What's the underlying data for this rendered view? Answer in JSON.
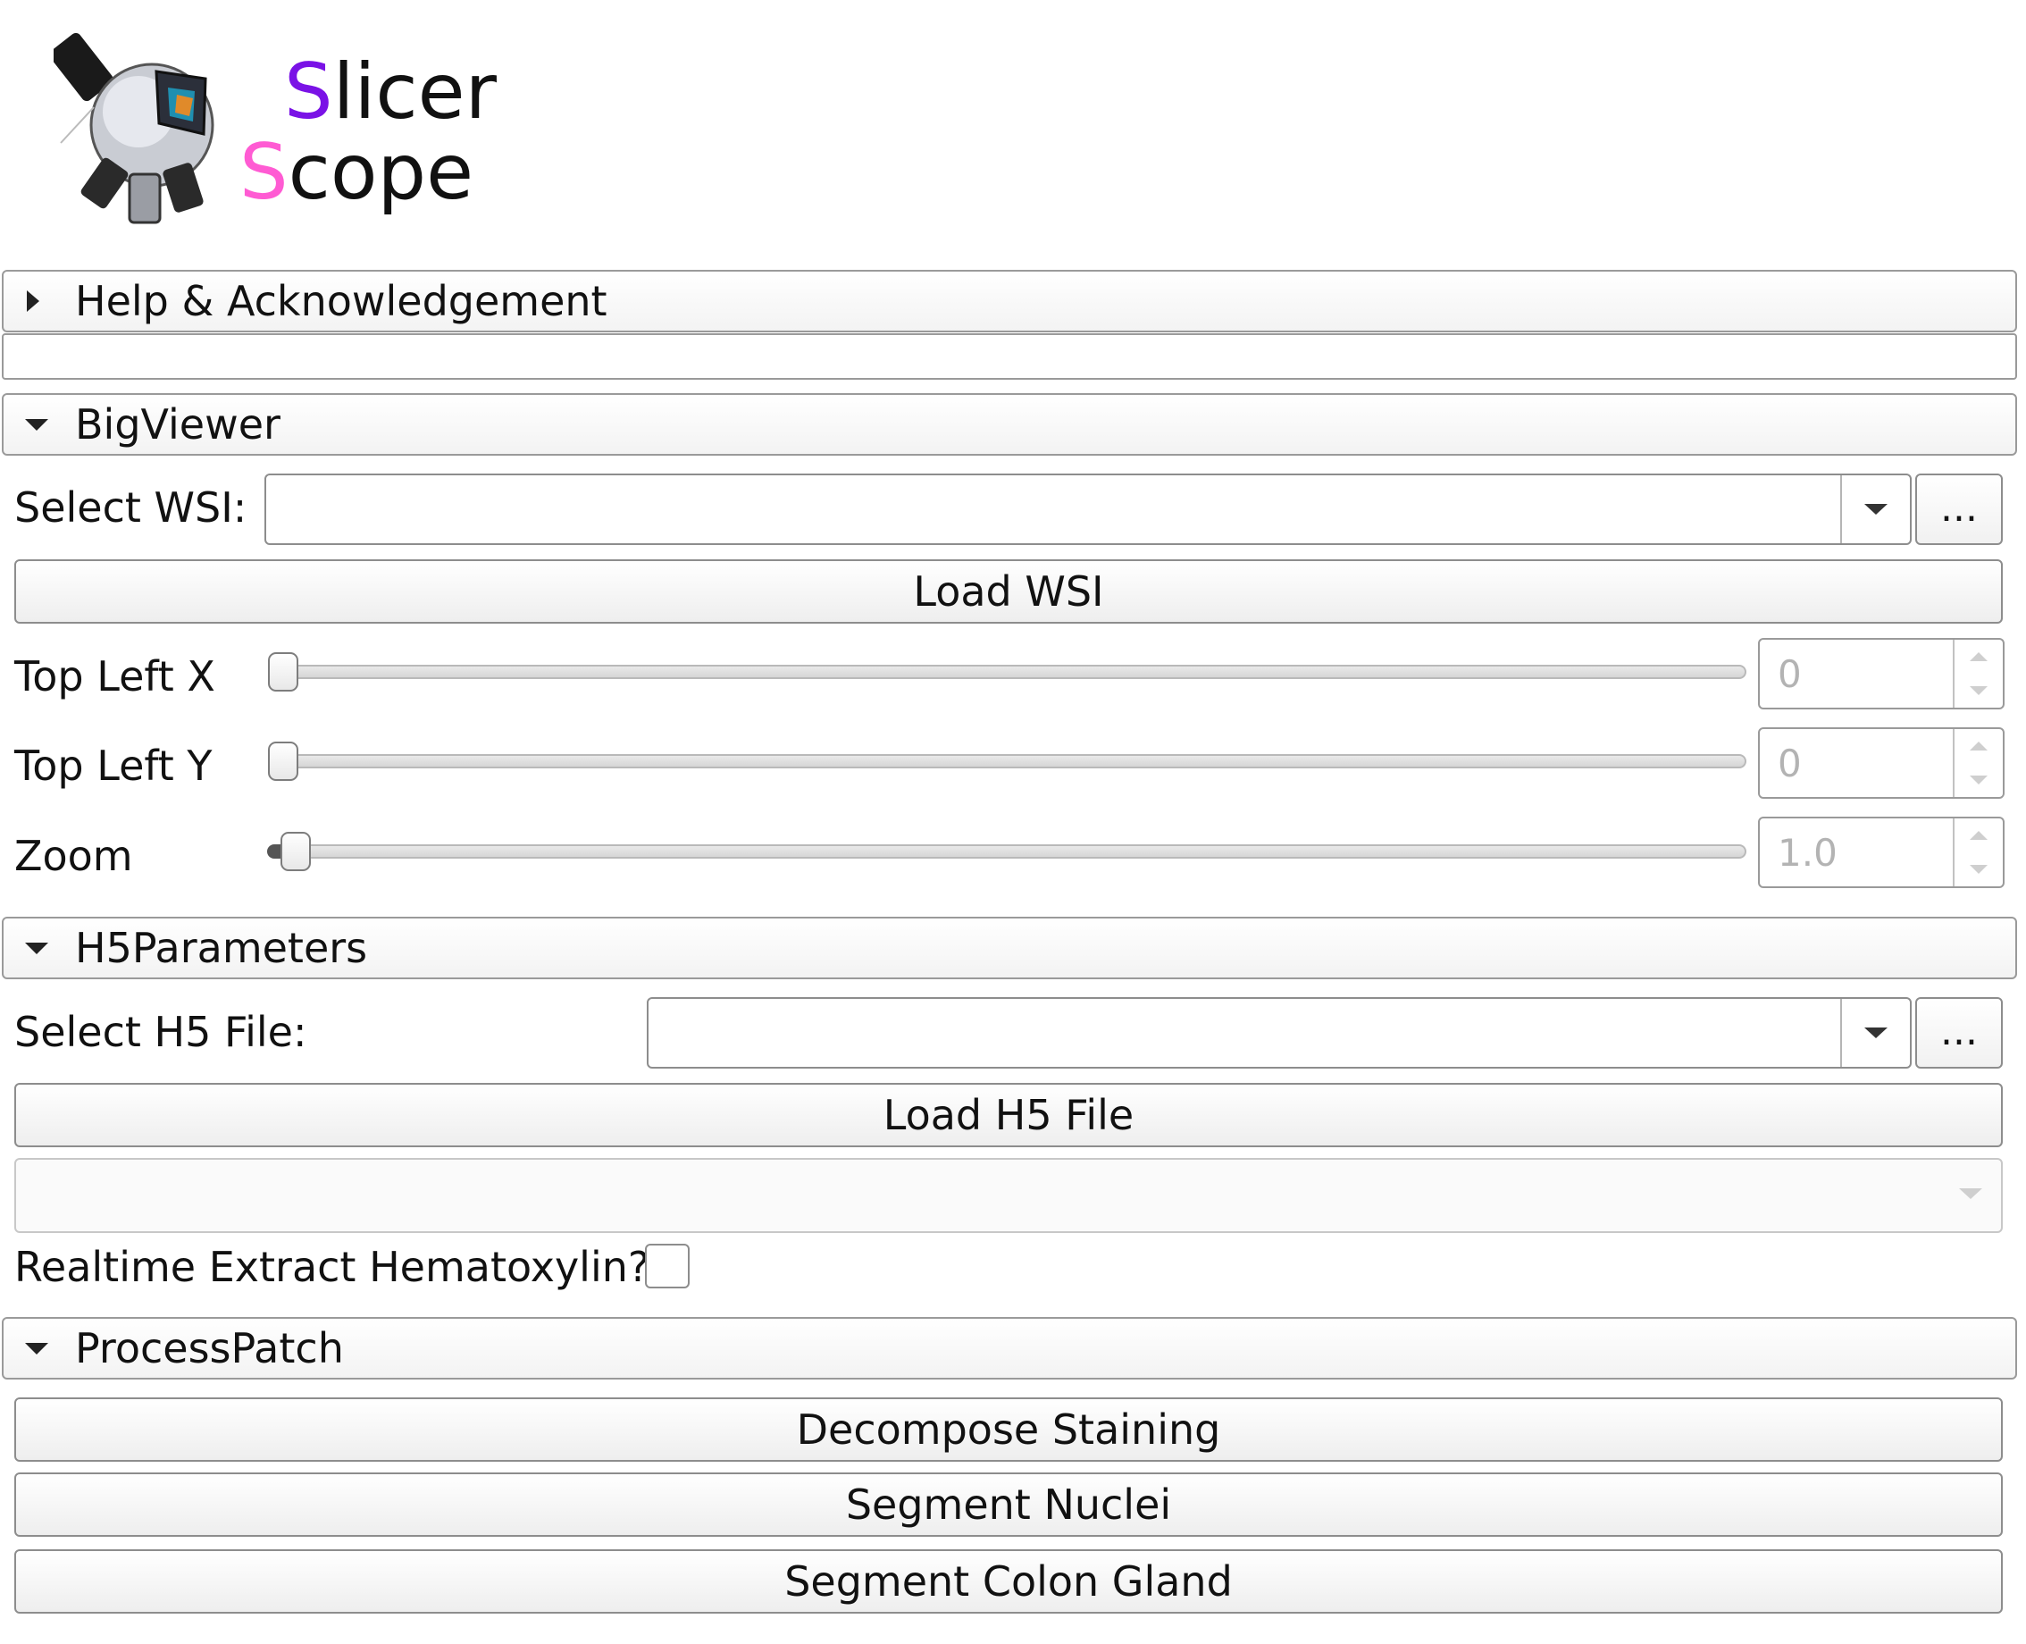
{
  "logo": {
    "word1_first": "S",
    "word1_rest": "licer",
    "word2_first": "S",
    "word2_rest": "cope",
    "color1": "#7a12e6",
    "color2": "#ff5bd3"
  },
  "sections": {
    "help": {
      "title": "Help & Acknowledgement",
      "icon": "chevron-right-icon",
      "expanded": false
    },
    "bigviewer": {
      "title": "BigViewer",
      "icon": "chevron-down-icon",
      "expanded": true
    },
    "h5params": {
      "title": "H5Parameters",
      "icon": "chevron-down-icon",
      "expanded": true
    },
    "process": {
      "title": "ProcessPatch",
      "icon": "chevron-down-icon",
      "expanded": true
    }
  },
  "bigviewer": {
    "select_wsi_label": "Select WSI:",
    "select_wsi_value": "",
    "browse_label": "...",
    "load_wsi_label": "Load WSI",
    "top_left_x_label": "Top Left X",
    "top_left_x_value": "0",
    "top_left_y_label": "Top Left Y",
    "top_left_y_value": "0",
    "zoom_label": "Zoom",
    "zoom_value": "1.0"
  },
  "h5params": {
    "select_h5_label": "Select H5 File:",
    "select_h5_value": "",
    "browse_label": "...",
    "load_h5_label": "Load H5 File",
    "dataset_combo_value": "",
    "realtime_label": "Realtime Extract Hematoxylin?",
    "realtime_checked": false
  },
  "process": {
    "decompose_label": "Decompose Staining",
    "segment_nuclei_label": "Segment Nuclei",
    "segment_gland_label": "Segment Colon Gland"
  }
}
